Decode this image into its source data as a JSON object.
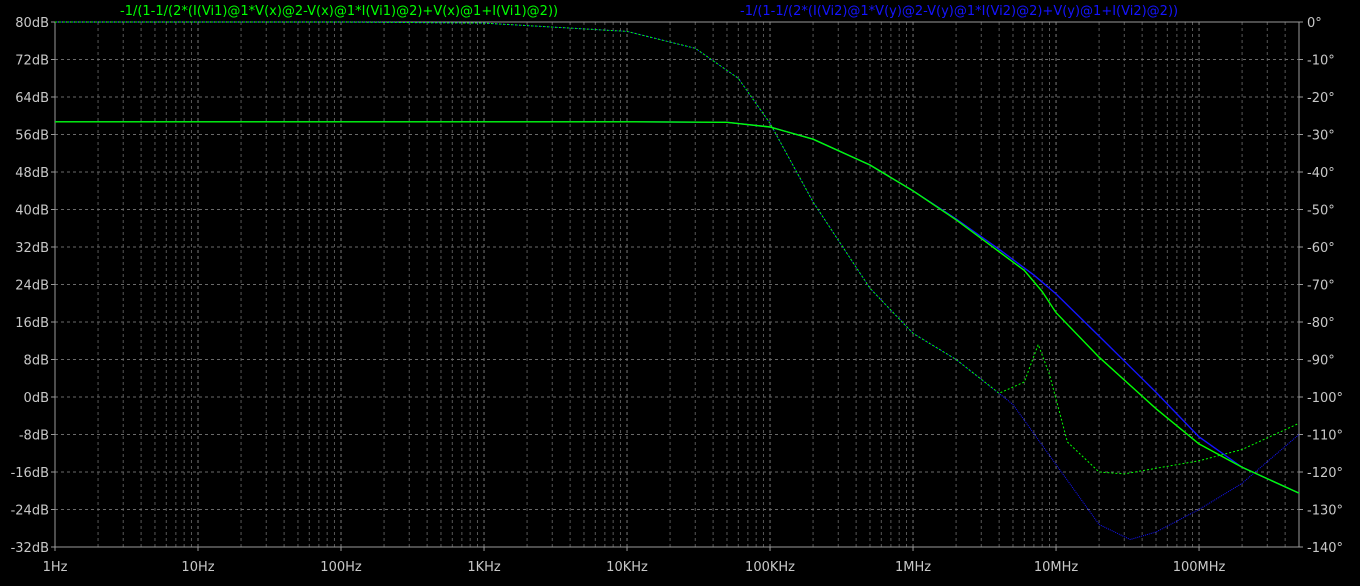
{
  "chart_data": {
    "type": "line",
    "title": "",
    "xscale": "log",
    "xlim": [
      1,
      500000000
    ],
    "ylim_left": [
      -32,
      80
    ],
    "ylim_right": [
      -140,
      0
    ],
    "left_unit": "dB",
    "right_unit": "°",
    "grid": true,
    "legend_placement": "top",
    "x_tick_labels": [
      "1Hz",
      "10Hz",
      "100Hz",
      "1KHz",
      "10KHz",
      "100KHz",
      "1MHz",
      "10MHz",
      "100MHz"
    ],
    "y_left_tick_labels": [
      "80dB",
      "72dB",
      "64dB",
      "56dB",
      "48dB",
      "40dB",
      "32dB",
      "24dB",
      "16dB",
      "8dB",
      "0dB",
      "-8dB",
      "-16dB",
      "-24dB",
      "-32dB"
    ],
    "y_right_tick_labels": [
      "0°",
      "-10°",
      "-20°",
      "-30°",
      "-40°",
      "-50°",
      "-60°",
      "-70°",
      "-80°",
      "-90°",
      "-100°",
      "-110°",
      "-120°",
      "-130°",
      "-140°"
    ],
    "series": [
      {
        "name": "-1/(1-1/(2*(I(Vi1)@1*V(x)@2-V(x)@1*I(Vi1)@2)+V(x)@1+I(Vi1)@2))",
        "color": "#00ff00",
        "magnitude": {
          "x": [
            1,
            10,
            100,
            1000,
            10000,
            50000,
            100000,
            200000,
            500000,
            1000000,
            2000000,
            4000000,
            6000000,
            8000000,
            10000000,
            20000000,
            50000000,
            100000000,
            200000000,
            500000000
          ],
          "y": [
            58.7,
            58.7,
            58.7,
            58.7,
            58.7,
            58.6,
            57.6,
            55.0,
            49.5,
            44.0,
            37.8,
            31.0,
            27.0,
            22.5,
            18.0,
            8.5,
            -2.5,
            -10.0,
            -15.0,
            -20.5
          ]
        },
        "phase": {
          "x": [
            1,
            10,
            100,
            1000,
            10000,
            30000,
            60000,
            100000,
            200000,
            500000,
            1000000,
            2000000,
            4000000,
            6000000,
            7500000,
            9000000,
            12000000,
            20000000,
            30000000,
            50000000,
            100000000,
            200000000,
            500000000
          ],
          "y": [
            0,
            0,
            0,
            -0.3,
            -2.5,
            -7.0,
            -15.0,
            -27.0,
            -48.0,
            -71.0,
            -83.0,
            -90.0,
            -99.0,
            -96.0,
            -86.0,
            -94.0,
            -112.0,
            -120.0,
            -120.5,
            -119.0,
            -117.0,
            -114.0,
            -107.0
          ]
        }
      },
      {
        "name": "-1/(1-1/(2*(I(Vi2)@1*V(y)@2-V(y)@1*I(Vi2)@2)+V(y)@1+I(Vi2)@2))",
        "color": "#1414ff",
        "magnitude": {
          "x": [
            1,
            10,
            100,
            1000,
            10000,
            50000,
            100000,
            200000,
            500000,
            1000000,
            2000000,
            4000000,
            7000000,
            10000000,
            20000000,
            50000000,
            100000000,
            200000000,
            500000000
          ],
          "y": [
            58.7,
            58.7,
            58.7,
            58.7,
            58.7,
            58.6,
            57.6,
            55.0,
            49.5,
            44.0,
            38.0,
            31.5,
            26.0,
            22.0,
            13.0,
            1.0,
            -8.5,
            -15.0,
            -20.5
          ]
        },
        "phase": {
          "x": [
            1,
            10,
            100,
            1000,
            10000,
            30000,
            60000,
            100000,
            200000,
            500000,
            1000000,
            2000000,
            5000000,
            10000000,
            20000000,
            33000000,
            50000000,
            100000000,
            200000000,
            500000000
          ],
          "y": [
            0,
            0,
            0,
            -0.3,
            -2.5,
            -7.0,
            -15.0,
            -27.0,
            -48.0,
            -71.0,
            -83.0,
            -90.0,
            -102.0,
            -118.0,
            -134.0,
            -138.0,
            -136.0,
            -130.0,
            -123.0,
            -110.0
          ]
        }
      }
    ]
  }
}
